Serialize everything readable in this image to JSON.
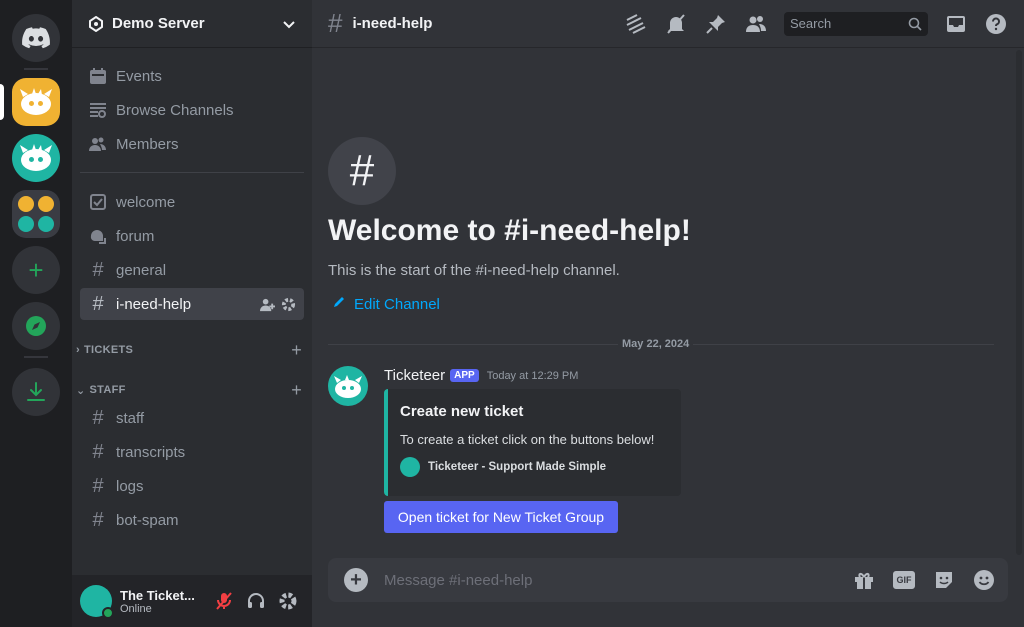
{
  "server": {
    "name": "Demo Server"
  },
  "sidebar": {
    "top_items": [
      {
        "label": "Events"
      },
      {
        "label": "Browse Channels"
      },
      {
        "label": "Members"
      }
    ],
    "channels": [
      {
        "label": "welcome"
      },
      {
        "label": "forum"
      },
      {
        "label": "general"
      },
      {
        "label": "i-need-help"
      }
    ],
    "categories": [
      {
        "label": "TICKETS"
      },
      {
        "label": "STAFF"
      }
    ],
    "staff_channels": [
      {
        "label": "staff"
      },
      {
        "label": "transcripts"
      },
      {
        "label": "logs"
      },
      {
        "label": "bot-spam"
      }
    ]
  },
  "user": {
    "name": "The Ticket...",
    "status": "Online"
  },
  "header": {
    "hash": "#",
    "channel": "i-need-help",
    "search_placeholder": "Search"
  },
  "welcome": {
    "hash": "#",
    "title": "Welcome to #i-need-help!",
    "subtitle": "This is the start of the #i-need-help channel.",
    "edit_label": "Edit Channel"
  },
  "messages": {
    "date": "May 22, 2024",
    "author": "Ticketeer",
    "badge": "APP",
    "time": "Today at 12:29 PM",
    "embed": {
      "title": "Create new ticket",
      "description": "To create a ticket click on the buttons below!",
      "footer": "Ticketeer - Support Made Simple"
    },
    "button_label": "Open ticket for New Ticket Group"
  },
  "composer": {
    "placeholder": "Message #i-need-help",
    "gif_label": "GIF"
  },
  "colors": {
    "accent": "#5865f2",
    "link": "#00a8fc",
    "online": "#23a55a",
    "bot_teal": "#1fb5a3",
    "server_yellow": "#f0b232"
  }
}
